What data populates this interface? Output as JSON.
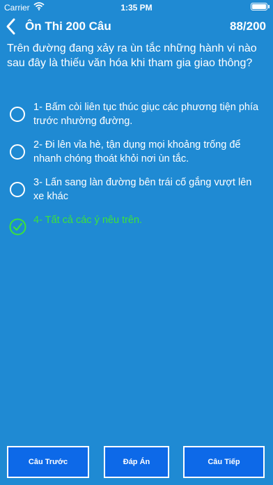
{
  "status_bar": {
    "carrier": "Carrier",
    "time": "1:35 PM",
    "icons": [
      "wifi-icon",
      "battery-icon"
    ]
  },
  "nav": {
    "back_icon": "chevron-left-icon",
    "title": "Ôn Thi 200 Câu",
    "counter": "88/200"
  },
  "question": "Trên đường đang xảy ra ùn tắc những hành vi nào sau đây là thiếu văn hóa khi tham gia giao thông?",
  "answers": [
    {
      "text": "1- Bấm còi liên tục thúc giục các phương tiện phía trước nhường đường.",
      "correct": false
    },
    {
      "text": "2- Đi lên vỉa hè, tận dụng mọi khoảng trống để nhanh chóng thoát khỏi nơi ùn tắc.",
      "correct": false
    },
    {
      "text": "3- Lấn sang làn đường bên trái cố gắng vượt lên xe khác",
      "correct": false
    },
    {
      "text": "4- Tất cả các ý nêu trên.",
      "correct": true
    }
  ],
  "buttons": {
    "prev": "Câu Trước",
    "answer": "Đáp Án",
    "next": "Câu Tiếp"
  },
  "colors": {
    "background": "#1f8ad3",
    "button": "#0d69e8",
    "correct": "#3be23b"
  }
}
